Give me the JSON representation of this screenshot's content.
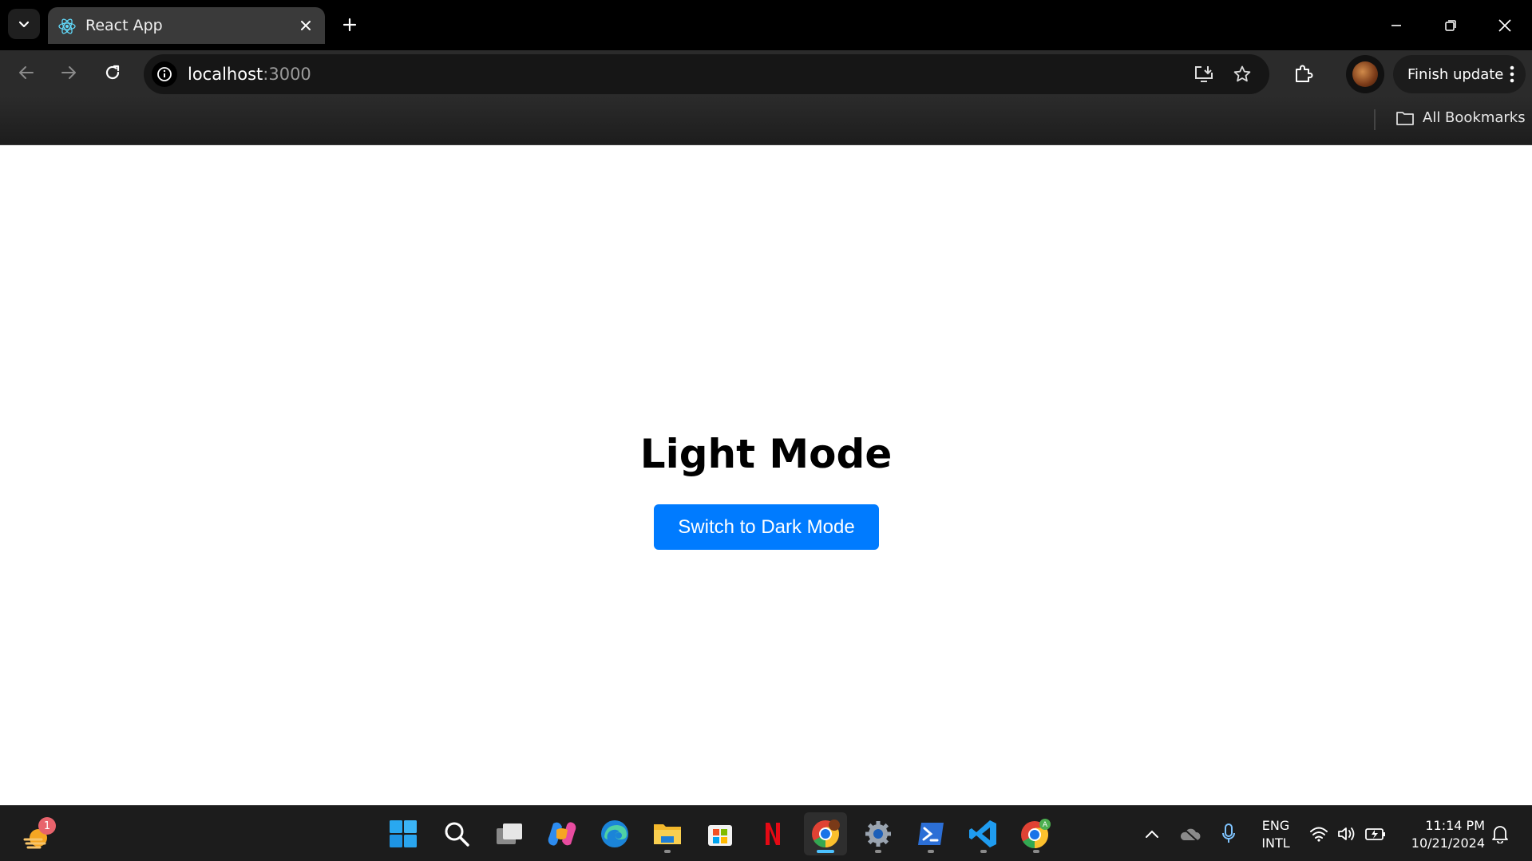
{
  "browser": {
    "tab": {
      "title": "React App"
    },
    "address": {
      "host": "localhost",
      "port": ":3000"
    },
    "update_button": {
      "label": "Finish update"
    },
    "bookmarks": {
      "all_label": "All Bookmarks"
    }
  },
  "page": {
    "heading": "Light Mode",
    "toggle_button": "Switch to Dark Mode"
  },
  "taskbar": {
    "widget_badge": "1",
    "pinned": [
      "start-icon",
      "search-icon",
      "task-view-icon",
      "copilot-icon",
      "edge-icon",
      "file-explorer-icon",
      "store-icon",
      "netflix-icon",
      "chrome-icon",
      "settings-icon",
      "terminal-icon",
      "vscode-icon",
      "chrome-profile-icon"
    ],
    "tray": {
      "lang_line1": "ENG",
      "lang_line2": "INTL",
      "time": "11:14 PM",
      "date": "10/21/2024"
    }
  },
  "colors": {
    "accent_button": "#007bff",
    "browser_frame": "#000000",
    "toolbar": "#2b2b2b"
  }
}
